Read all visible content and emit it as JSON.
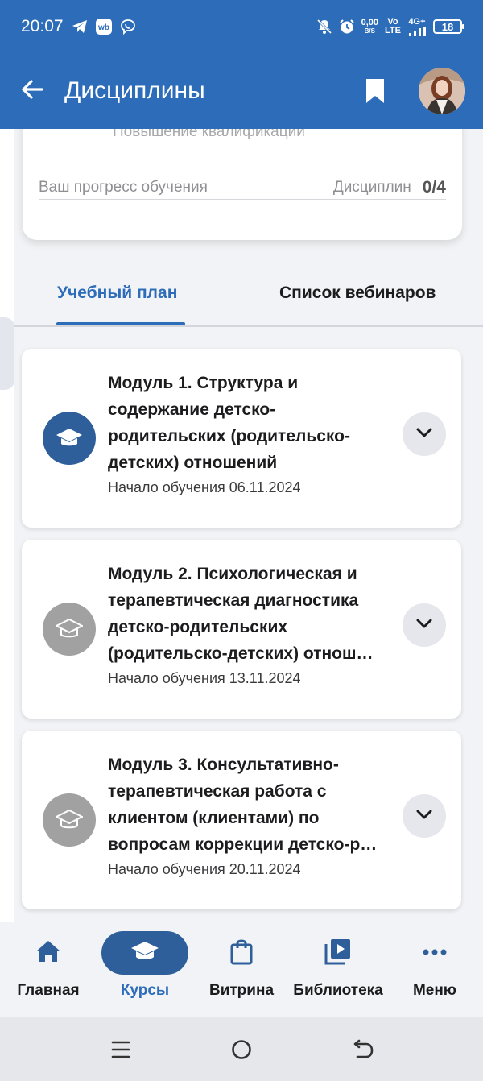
{
  "status_bar": {
    "time": "20:07",
    "net_speed_value": "0,00",
    "net_speed_unit": "B/S",
    "volte_top": "Vo",
    "volte_bottom": "LTE",
    "network": "4G+",
    "battery": "18",
    "icons": [
      "telegram-icon",
      "wb-icon",
      "viber-icon",
      "mute-icon",
      "alarm-icon",
      "signal-icon",
      "battery-icon"
    ]
  },
  "app_bar": {
    "title": "Дисциплины",
    "icons": [
      "back-arrow-icon",
      "bookmark-icon",
      "avatar"
    ]
  },
  "progress_card": {
    "course_kind": "Повышение квалификации",
    "progress_label": "Ваш прогресс обучения",
    "disciplines_label": "Дисциплин",
    "disciplines_count": "0/4"
  },
  "tabs": [
    {
      "label": "Учебный план",
      "active": true
    },
    {
      "label": "Список вебинаров",
      "active": false
    }
  ],
  "modules": [
    {
      "title": "Модуль 1. Структура и содержание детско-родительских (родительско-детских) отношений",
      "date": "Начало обучения 06.11.2024",
      "icon_color": "#2e5f9a"
    },
    {
      "title": "Модуль 2. Психологическая и терапевтическая диагностика детско-родительских (родительско-детских) отнош…",
      "date": "Начало обучения 13.11.2024",
      "icon_color": "#a1a1a1"
    },
    {
      "title": "Модуль 3. Консультативно-терапевтическая работа с клиентом (клиентами) по вопросам коррекции детско-р…",
      "date": "Начало обучения 20.11.2024",
      "icon_color": "#a1a1a1"
    }
  ],
  "bottom_nav": [
    {
      "label": "Главная",
      "icon": "home-icon",
      "active": false
    },
    {
      "label": "Курсы",
      "icon": "graduation-cap-icon",
      "active": true
    },
    {
      "label": "Витрина",
      "icon": "shopping-bag-icon",
      "active": false
    },
    {
      "label": "Библиотека",
      "icon": "video-library-icon",
      "active": false
    },
    {
      "label": "Меню",
      "icon": "more-dots-icon",
      "active": false
    }
  ],
  "system_nav": [
    "recents-icon",
    "home-circle-icon",
    "back-icon"
  ],
  "colors": {
    "primary": "#2c6cb8",
    "module_icon_active": "#2e5f9a",
    "module_icon_inactive": "#a1a1a1"
  }
}
